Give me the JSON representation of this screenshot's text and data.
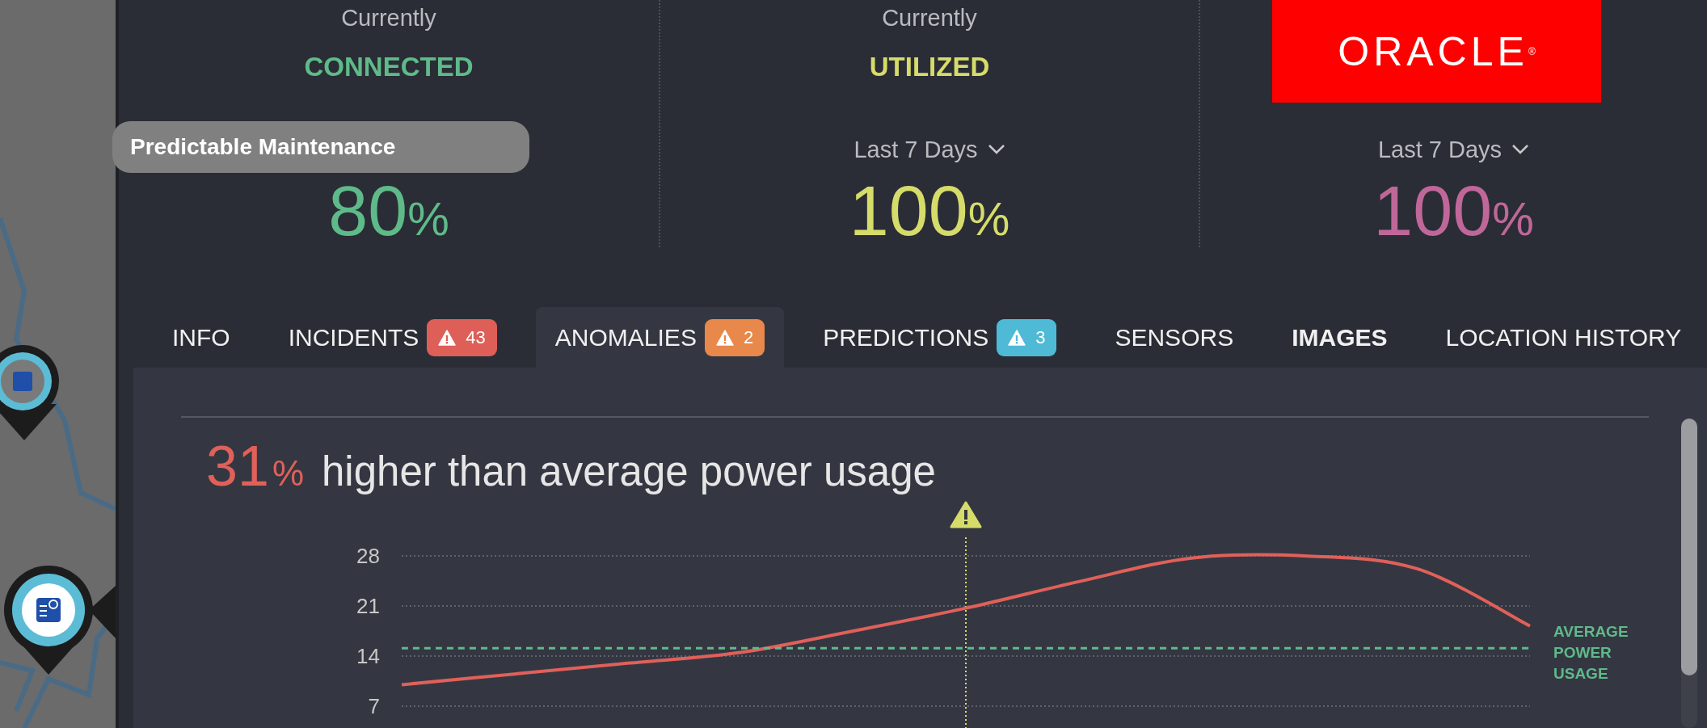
{
  "tooltip": {
    "text": "Predictable Maintenance"
  },
  "logo": {
    "text": "ORACLE$^{®}$"
  },
  "stats": [
    {
      "caption": "Currently",
      "status": "CONNECTED",
      "value": "80",
      "unit": "%",
      "color": "#5fba8a"
    },
    {
      "caption": "Currently",
      "status": "UTILIZED",
      "period": "Last 7 Days",
      "value": "100",
      "unit": "%",
      "color": "#d6dc6a"
    },
    {
      "period": "Last 7 Days",
      "value": "100",
      "unit": "%",
      "color": "#c0679a"
    }
  ],
  "tabs": [
    {
      "label": "INFO",
      "selected": false,
      "bold": false
    },
    {
      "label": "INCIDENTS",
      "selected": false,
      "bold": false,
      "badge": {
        "count": "43",
        "color": "#de5f57"
      }
    },
    {
      "label": "ANOMALIES",
      "selected": true,
      "bold": false,
      "badge": {
        "count": "2",
        "color": "#e8884a"
      }
    },
    {
      "label": "PREDICTIONS",
      "selected": false,
      "bold": false,
      "badge": {
        "count": "3",
        "color": "#4fbad5"
      }
    },
    {
      "label": "SENSORS",
      "selected": false,
      "bold": false
    },
    {
      "label": "IMAGES",
      "selected": false,
      "bold": true
    },
    {
      "label": "LOCATION HISTORY",
      "selected": false,
      "bold": false
    }
  ],
  "headline": {
    "value": "31",
    "unit": "%",
    "text": "higher than average power usage"
  },
  "chart_data": {
    "type": "line",
    "ylim": [
      7,
      28
    ],
    "yticks": [
      7,
      14,
      21,
      28
    ],
    "series": [
      {
        "color": "#e0605a",
        "values": [
          10.0,
          11.5,
          13.0,
          14.5,
          17.5,
          20.7,
          24.4,
          27.7,
          28.0,
          26.2,
          18.2
        ]
      },
      {
        "name": "AVERAGE POWER USAGE",
        "color": "#5fba8a",
        "line_style": "dashed",
        "values": [
          15.1,
          15.1,
          15.1,
          15.1,
          15.1,
          15.1,
          15.1,
          15.1,
          15.1,
          15.1,
          15.1
        ]
      }
    ]
  }
}
